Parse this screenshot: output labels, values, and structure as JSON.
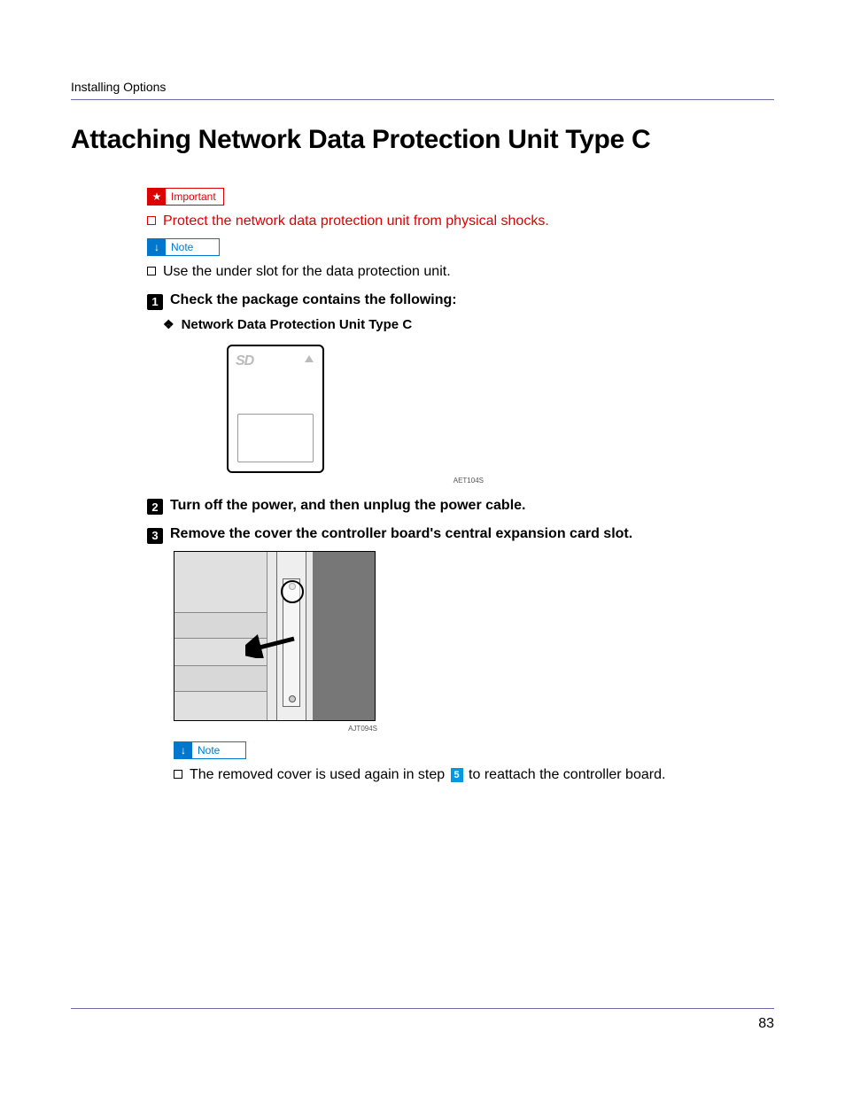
{
  "header": {
    "section": "Installing Options"
  },
  "title": "Attaching Network Data Protection Unit Type C",
  "important": {
    "label": "Important",
    "items": [
      "Protect the network data protection unit from physical shocks."
    ]
  },
  "note1": {
    "label": "Note",
    "items": [
      "Use the under slot for the data protection unit."
    ]
  },
  "steps": {
    "s1": {
      "num": "1",
      "text": "Check the package contains the following:"
    },
    "s2": {
      "num": "2",
      "text": "Turn off the power, and then unplug the power cable."
    },
    "s3": {
      "num": "3",
      "text": "Remove the cover the controller board's central expansion card slot."
    }
  },
  "package_item": "Network Data Protection Unit Type C",
  "fig1_caption": "AET104S",
  "fig2_caption": "AJT094S",
  "note2": {
    "label": "Note",
    "text_before": "The removed cover is used again in step ",
    "step_ref": "5",
    "text_after": " to reattach the controller board."
  },
  "page_number": "83"
}
